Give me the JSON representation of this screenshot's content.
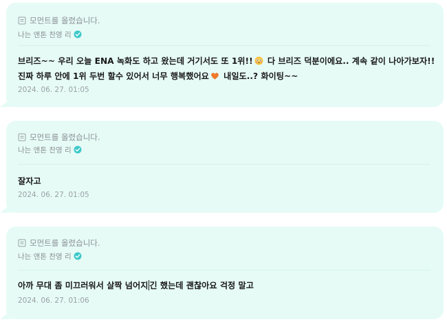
{
  "moments": [
    {
      "notice": "모먼트를 올렸습니다.",
      "author": "나는 앤톤 찬영 리",
      "message_lines": [
        {
          "before": "브리즈~~ 우리 오늘 ENA 녹화도 하고 왔는데 거기서도 또 1위!!",
          "emoji": "flushed-face-emoji",
          "after": " 다 브리즈 덕분이에요.. 계속 같이 나아가보자!!"
        },
        {
          "before": "진짜 하루 안에 1위 두번 할수 있어서 너무 행복했어요",
          "emoji": "orange-heart-emoji",
          "after": " 내일도..? 화이팅~~"
        }
      ],
      "timestamp": "2024. 06. 27. 01:05"
    },
    {
      "notice": "모먼트를 올렸습니다.",
      "author": "나는 앤톤 찬영 리",
      "message": "잘자고",
      "timestamp": "2024. 06. 27. 01:05"
    },
    {
      "notice": "모먼트를 올렸습니다.",
      "author": "나는 앤톤 찬영 리",
      "message_before_cursor": "아까 무대 좀 미끄러워서 살짝 넘어지",
      "message_after_cursor": "긴 했는데 괜찮아요 걱정 말고",
      "timestamp": "2024. 06. 27. 01:06"
    }
  ],
  "colors": {
    "bubble_bg": "#e6fbf6",
    "verified": "#3ec9c9",
    "heart": "#f07a2a"
  }
}
